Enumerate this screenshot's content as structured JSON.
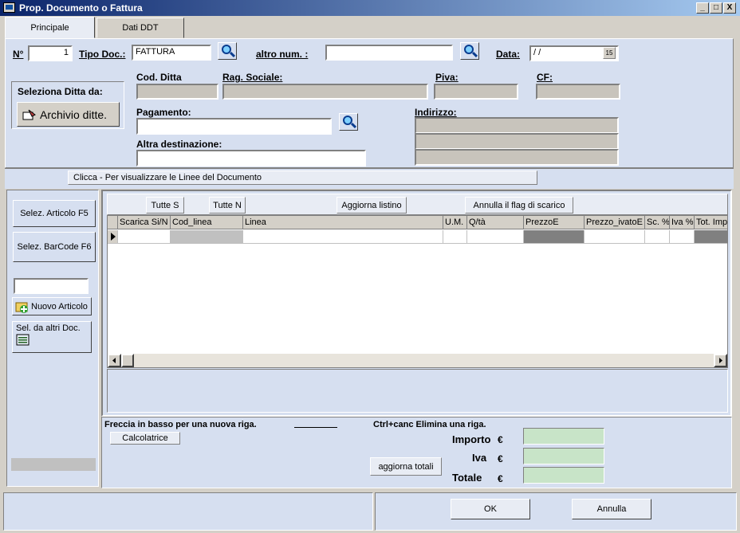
{
  "window": {
    "title": "Prop. Documento o Fattura",
    "min": "_",
    "max": "□",
    "close": "X"
  },
  "tabs": [
    {
      "label": "Principale"
    },
    {
      "label": "Dati DDT"
    }
  ],
  "header": {
    "numero_label": "N°",
    "numero_value": "1",
    "tipo_label": "Tipo Doc.:",
    "tipo_value": "FATTURA",
    "altro_label": "altro num. :",
    "altro_value": "",
    "data_label": "Data:",
    "data_value": " / /",
    "cal_glyph": "15"
  },
  "ditta": {
    "seleziona_label": "Seleziona Ditta da:",
    "archivio_button": "Archivio ditte.",
    "cod_label": "Cod. Ditta",
    "rag_label": "Rag. Sociale:",
    "piva_label": "Piva:",
    "cf_label": "CF:",
    "pagamento_label": "Pagamento:",
    "indirizzo_label": "Indirizzo:",
    "altra_label": "Altra destinazione:"
  },
  "linee_bar": {
    "text": "Clicca - Per visualizzare le  Linee del Documento"
  },
  "left_panel": {
    "selez_articolo": "Selez. Articolo F5",
    "selez_barcode": "Selez. BarCode F6",
    "barcode_input": "",
    "nuovo_articolo": "Nuovo Articolo",
    "sel_altri": "Sel. da altri Doc."
  },
  "grid_toolbar": {
    "tutte_s": "Tutte S",
    "tutte_n": "Tutte N",
    "aggiorna_listino": "Aggiorna listino",
    "annulla_flag": "Annulla il flag di scarico"
  },
  "grid": {
    "columns": [
      "Scarica Si/N",
      "Cod_linea",
      "Linea",
      "U.M.",
      "Q/tà",
      "PrezzoE",
      "Prezzo_ivatoE",
      "Sc. %",
      "Iva %",
      "Tot. Imp"
    ]
  },
  "footer": {
    "hint_nuova": "Freccia in basso per una nuova riga.",
    "hint_canc": "Ctrl+canc  Elimina una riga.",
    "calcolatrice": "Calcolatrice",
    "aggiorna_totali": "aggiorna totali",
    "importo_label": "Importo",
    "iva_label": "Iva",
    "totale_label": "Totale",
    "currency": "€",
    "importo_value": "",
    "iva_value": "",
    "totale_value": ""
  },
  "bottom": {
    "ok": "OK",
    "annulla": "Annulla"
  },
  "colors": {
    "title_start": "#0a246a",
    "panel": "#d6dff0",
    "total_field": "#c8e4c8"
  }
}
